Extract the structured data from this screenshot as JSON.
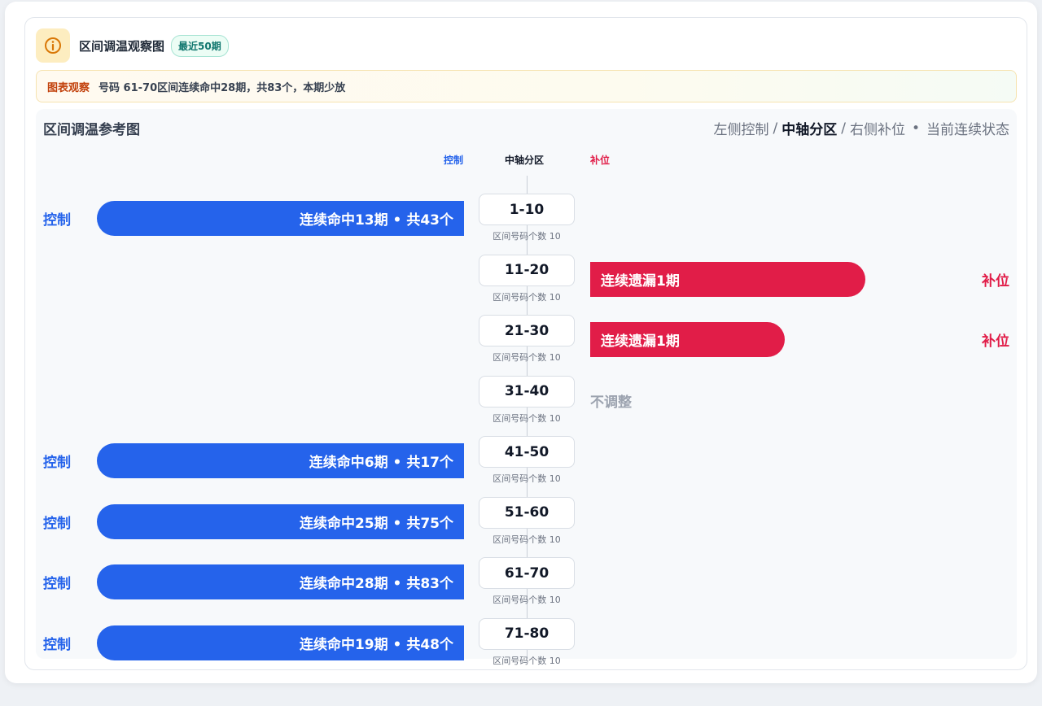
{
  "header": {
    "title": "区间调温观察图",
    "badge": "最近50期",
    "icon": "info-icon",
    "accent": "#d97706"
  },
  "notice": {
    "label": "图表观察",
    "text": "号码 61-70区间连续命中28期，共83个，本期少放"
  },
  "panel": {
    "title": "区间调温参考图",
    "legend": {
      "left": "左侧控制",
      "sep1": "/",
      "mid": "中轴分区",
      "sep2": "/",
      "right": "右侧补位",
      "dot": "•",
      "status": "当前连续状态"
    },
    "columns": {
      "left": "控制",
      "mid": "中轴分区",
      "right": "补位"
    }
  },
  "colors": {
    "control": "#2563eb",
    "fill": "#e11d48",
    "neutral": "#9ca3af"
  },
  "rows": [
    {
      "range": "1-10",
      "sub": "区间号码个数 10",
      "type": "control",
      "side_label": "控制",
      "bar_text": "连续命中13期 • 共43个",
      "right_label": "",
      "neutral_text": ""
    },
    {
      "range": "11-20",
      "sub": "区间号码个数 10",
      "type": "fill",
      "side_label": "",
      "bar_text": "连续遗漏1期",
      "right_label": "补位",
      "neutral_text": ""
    },
    {
      "range": "21-30",
      "sub": "区间号码个数 10",
      "type": "fill",
      "side_label": "",
      "bar_text": "连续遗漏1期",
      "right_label": "补位",
      "neutral_text": ""
    },
    {
      "range": "31-40",
      "sub": "区间号码个数 10",
      "type": "neutral",
      "side_label": "",
      "bar_text": "",
      "right_label": "",
      "neutral_text": "不调整"
    },
    {
      "range": "41-50",
      "sub": "区间号码个数 10",
      "type": "control",
      "side_label": "控制",
      "bar_text": "连续命中6期 • 共17个",
      "right_label": "",
      "neutral_text": ""
    },
    {
      "range": "51-60",
      "sub": "区间号码个数 10",
      "type": "control",
      "side_label": "控制",
      "bar_text": "连续命中25期 • 共75个",
      "right_label": "",
      "neutral_text": ""
    },
    {
      "range": "61-70",
      "sub": "区间号码个数 10",
      "type": "control",
      "side_label": "控制",
      "bar_text": "连续命中28期 • 共83个",
      "right_label": "",
      "neutral_text": ""
    },
    {
      "range": "71-80",
      "sub": "区间号码个数 10",
      "type": "control",
      "side_label": "控制",
      "bar_text": "连续命中19期 • 共48个",
      "right_label": "",
      "neutral_text": ""
    }
  ]
}
